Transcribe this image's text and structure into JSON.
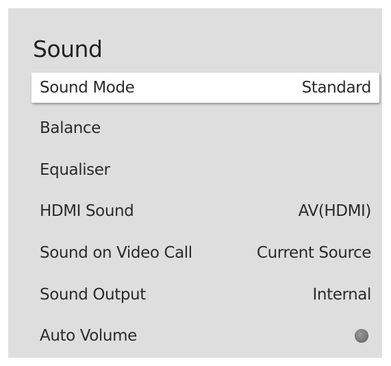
{
  "menu": {
    "title": "Sound",
    "items": [
      {
        "label": "Sound Mode",
        "value": "Standard"
      },
      {
        "label": "Balance",
        "value": ""
      },
      {
        "label": "Equaliser",
        "value": ""
      },
      {
        "label": "HDMI Sound",
        "value": "AV(HDMI)"
      },
      {
        "label": "Sound on Video Call",
        "value": "Current Source"
      },
      {
        "label": "Sound Output",
        "value": "Internal"
      },
      {
        "label": "Auto Volume",
        "value": "",
        "toggle_state": "off"
      }
    ],
    "selected_index": 0
  }
}
